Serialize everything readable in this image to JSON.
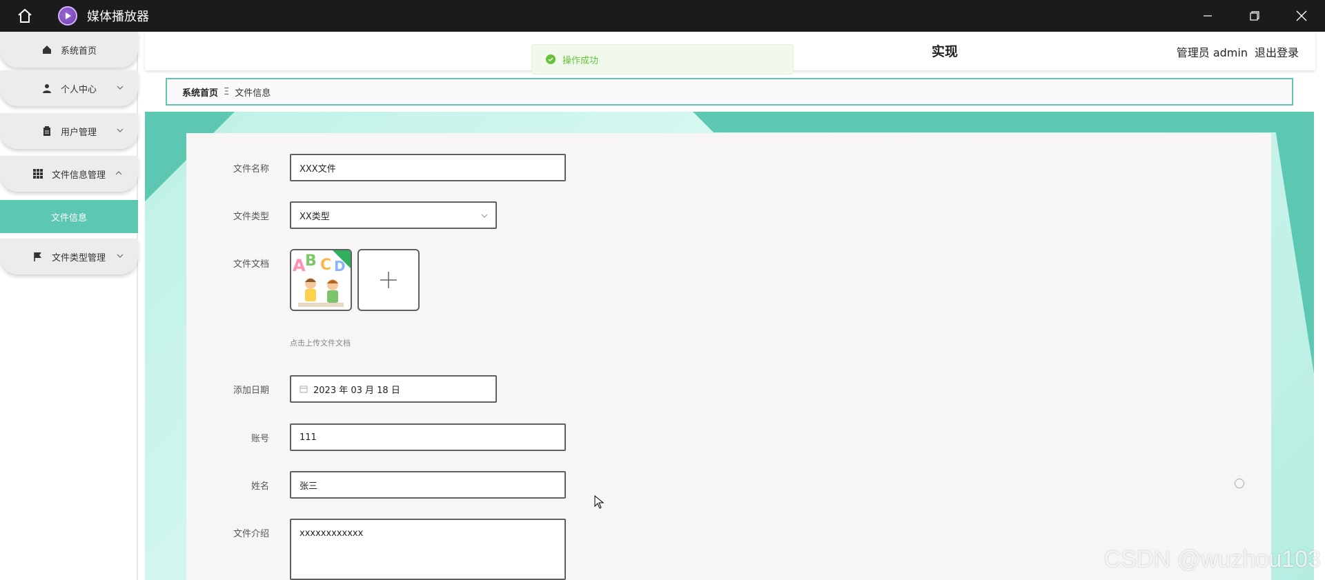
{
  "window": {
    "title": "媒体播放器"
  },
  "sidebar": {
    "items": [
      {
        "label": "系统首页",
        "icon": "home-icon"
      },
      {
        "label": "个人中心",
        "icon": "user-icon"
      },
      {
        "label": "用户管理",
        "icon": "clipboard-icon"
      },
      {
        "label": "文件信息管理",
        "icon": "grid-icon"
      },
      {
        "label": "文件类型管理",
        "icon": "flag-icon"
      }
    ],
    "active_sub": "文件信息"
  },
  "header": {
    "title": "实现",
    "user_label": "管理员 admin",
    "logout": "退出登录"
  },
  "toast": {
    "message": "操作成功",
    "color": "#67c23a"
  },
  "breadcrumb": {
    "home": "系统首页",
    "separator": "Ξ",
    "current": "文件信息"
  },
  "form": {
    "file_name_label": "文件名称",
    "file_name": "XXX文件",
    "file_type_label": "文件类型",
    "file_type": "XX类型",
    "file_doc_label": "文件文档",
    "upload_hint": "点击上传文件文档",
    "date_label": "添加日期",
    "date_value": "2023 年 03 月 18 日",
    "account_label": "账号",
    "account": "111",
    "name_label": "姓名",
    "name": "张三",
    "intro_label": "文件介绍",
    "intro": "xxxxxxxxxxxx"
  },
  "watermark": "CSDN @wuzhou103",
  "colors": {
    "accent": "#5cc8b2",
    "titlebar": "#1b1b1b"
  }
}
